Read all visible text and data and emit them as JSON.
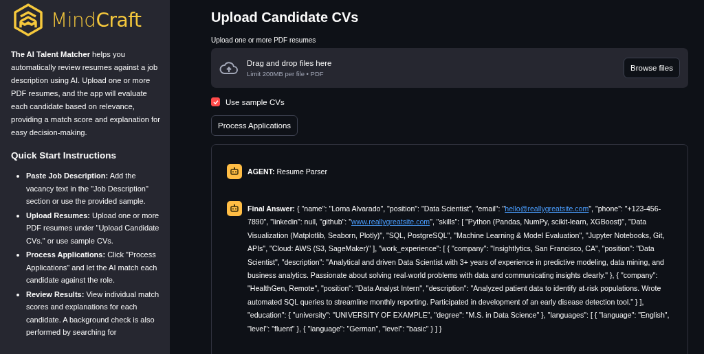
{
  "sidebar": {
    "logo": "Mind**Craft**",
    "intro": "**The AI Talent Matcher** helps you automatically review resumes against a job description using AI. Upload one or more PDF resumes, and the app will evaluate each candidate based on relevance, providing a match score and explanation for easy decision-making.",
    "instructions_title": "Quick Start Instructions",
    "instructions": [
      "**Paste Job Description:** Add the vacancy text in the \"Job Description\" section or use the provided sample.",
      "**Upload Resumes:** Upload one or more PDF resumes under \"Upload Candidate CVs.\" or use sample CVs.",
      "**Process Applications:** Click \"Process Applications\" and let the AI match each candidate against the role.",
      "**Review Results:** View individual match scores and explanations for each candidate. A background check is also performed by searching for"
    ]
  },
  "main": {
    "title": "Upload Candidate CVs",
    "uploader": {
      "label": "Upload one or more PDF resumes",
      "drop_text": "Drag and drop files here",
      "limit": "Limit 200MB per file • PDF",
      "button": "Browse files"
    },
    "sample_checkbox": {
      "label": "Use sample CVs",
      "checked": true
    },
    "process_button": "Process Applications",
    "messages": [
      {
        "segments": [
          {
            "kind": "text",
            "text": "**AGENT:** Resume Parser"
          }
        ]
      },
      {
        "segments": [
          {
            "kind": "text",
            "text": "**Final Answer:** { \"name\": \"Lorna Alvarado\", \"position\": \"Data Scientist\", \"email\": \""
          },
          {
            "kind": "link",
            "text": "hello@reallygreatsite.com"
          },
          {
            "kind": "text",
            "text": "\", \"phone\": \"+123-456-7890\", \"linkedin\": null, \"github\": \""
          },
          {
            "kind": "link",
            "text": "www.reallygreatsite.com"
          },
          {
            "kind": "text",
            "text": "\", \"skills\": [ \"Python (Pandas, NumPy, scikit-learn, XGBoost)\", \"Data Visualization (Matplotlib, Seaborn, Plotly)\", \"SQL, PostgreSQL\", \"Machine Learning & Model Evaluation\", \"Jupyter Notebooks, Git, APIs\", \"Cloud: AWS (S3, SageMaker)\" ], \"work_experience\": [ { \"company\": \"Insightlytics, San Francisco, CA\", \"position\": \"Data Scientist\", \"description\": \"Analytical and driven Data Scientist with 3+ years of experience in predictive modeling, data mining, and business analytics. Passionate about solving real-world problems with data and communicating insights clearly.\" }, { \"company\": \"HealthGen, Remote\", \"position\": \"Data Analyst Intern\", \"description\": \"Analyzed patient data to identify at-risk populations. Wrote automated SQL queries to streamline monthly reporting. Participated in development of an early disease detection tool.\" } ], \"education\": { \"university\": \"UNIVERSITY OF EXAMPLE\", \"degree\": \"M.S. in Data Science\" }, \"languages\": [ { \"language\": \"English\", \"level\": \"fluent\" }, { \"language\": \"German\", \"level\": \"basic\" } ] }"
          }
        ]
      }
    ]
  }
}
